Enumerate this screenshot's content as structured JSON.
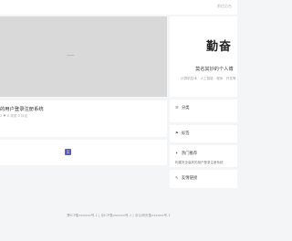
{
  "topbar": {
    "right_text": "前往后台"
  },
  "banner": {},
  "post": {
    "title": "的用户登录注册系统",
    "meta": "2  ♥ 0 浏览  0 评论"
  },
  "pager": {
    "current": "1"
  },
  "profile": {
    "logo_text": "勤奋",
    "name": "莫名其妙的个人博",
    "tags": "计算机技术 · 人工智能 · 程序 · 开发等"
  },
  "widgets": {
    "categories": {
      "title": "分类"
    },
    "tags": {
      "title": "标签"
    },
    "hot": {
      "title": "热门推荐",
      "item": "构建安全高效的用户登录注册系统"
    },
    "links": {
      "title": "友情链接"
    }
  },
  "footer": {
    "text": "豫ICP备xxxxxx号-1 | 京ICP备xxxxxx号-1 | 京公网安备xxxxxx号-1"
  }
}
